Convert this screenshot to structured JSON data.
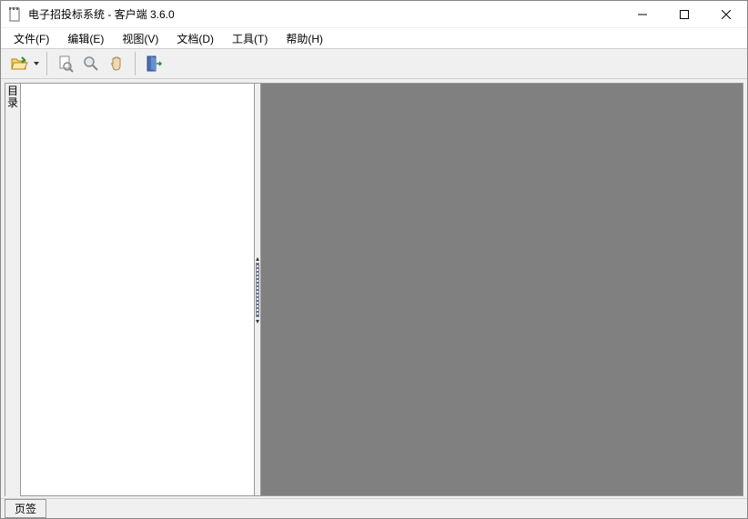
{
  "window": {
    "title": "电子招投标系统 - 客户端 3.6.0"
  },
  "menu": {
    "file": "文件(F)",
    "edit": "编辑(E)",
    "view": "视图(V)",
    "document": "文档(D)",
    "tools": "工具(T)",
    "help": "帮助(H)"
  },
  "sidebar": {
    "tab_label_1": "目",
    "tab_label_2": "录"
  },
  "status": {
    "tab": "页签"
  },
  "icons": {
    "open": "open-folder-icon",
    "fit": "fit-page-icon",
    "zoom": "magnifier-icon",
    "pan": "hand-icon",
    "exit": "exit-door-icon"
  }
}
